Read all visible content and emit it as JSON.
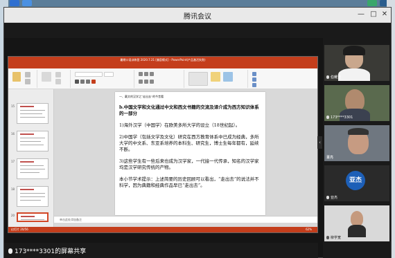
{
  "window": {
    "title": "腾讯会议"
  },
  "ppt": {
    "title_bar": "暑期口语训练营 2020.7.21 [兼容模式] - PowerPoint(产品激活失败)",
    "tabs": [
      "文件",
      "开始",
      "插入",
      "设计",
      "切换",
      "动画",
      "幻灯片放映",
      "审阅",
      "视图",
      "加载项"
    ],
    "slide_numbers": [
      "15",
      "16",
      "17",
      "18",
      "19",
      "20"
    ],
    "notes_placeholder": "单击此处添加备注",
    "status_left": "幻灯片 20/56",
    "zoom": "62%",
    "slide": {
      "header": "一、戴文的汉学之“走出去”的今昔看",
      "paragraphs": [
        {
          "text": "b.中国文学和文化通过中文和西文书籍的交流及译介成为西方知识体系的一部分",
          "bold": false
        },
        {
          "text": "1)海外汉学（中国学）在欧美多所大学的设立（18世纪起）。",
          "bold": false
        },
        {
          "text": "2)中国学（包括文学及文化）研究在西方教育体系中已成为经典，多所大学的中文系、东亚系培养的本科生、研究生，博士生每年都有，延续不断。",
          "bold": false
        },
        {
          "text": "3)这些学生有一些后来也成为汉学家，一代接一代传承，知名的汉学家均是汉学研究传统的产物。",
          "bold": false
        },
        {
          "text": "本小节学术提示：上述简要的历史回顾可以看出，“走出去”的说法并不科学，因为典籍和经典作品早已“走出去”。",
          "bold": false
        }
      ]
    }
  },
  "participants": [
    {
      "name": "伯耀浩",
      "type": "video"
    },
    {
      "name": "173****3301",
      "type": "video"
    },
    {
      "name": "董亮",
      "type": "video"
    },
    {
      "name": "亚杰",
      "type": "avatar",
      "avatar_text": "亚杰"
    },
    {
      "name": "柳学宽",
      "type": "video"
    }
  ],
  "bottom": {
    "share_label": "173****3301的屏幕共享"
  },
  "colors": {
    "ppt_accent": "#c43e1c",
    "avatar_blue": "#1d5fb7"
  }
}
